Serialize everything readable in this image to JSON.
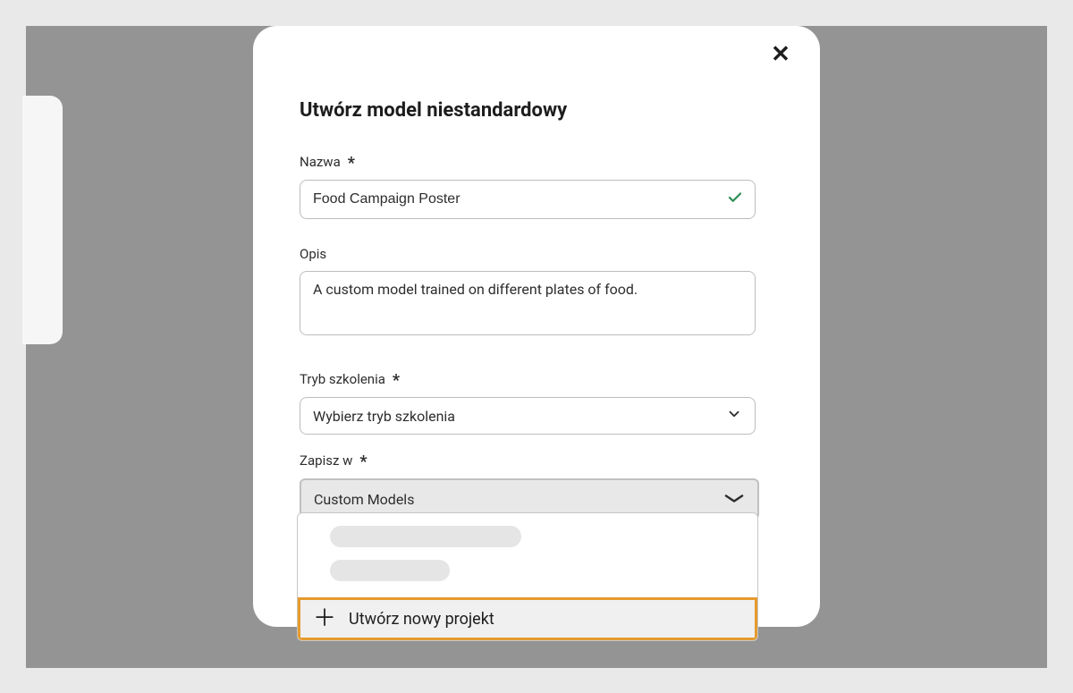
{
  "modal": {
    "title": "Utwórz model niestandardowy",
    "close_label": "✕",
    "name": {
      "label": "Nazwa",
      "value": "Food Campaign Poster",
      "required": "*"
    },
    "description": {
      "label": "Opis",
      "value": "A custom model trained on different plates of food."
    },
    "training_mode": {
      "label": "Tryb szkolenia",
      "placeholder": "Wybierz tryb szkolenia",
      "required": "*"
    },
    "save_in": {
      "label": "Zapisz w",
      "selected": "Custom Models",
      "required": "*"
    },
    "dropdown": {
      "create_label": "Utwórz nowy projekt"
    }
  }
}
